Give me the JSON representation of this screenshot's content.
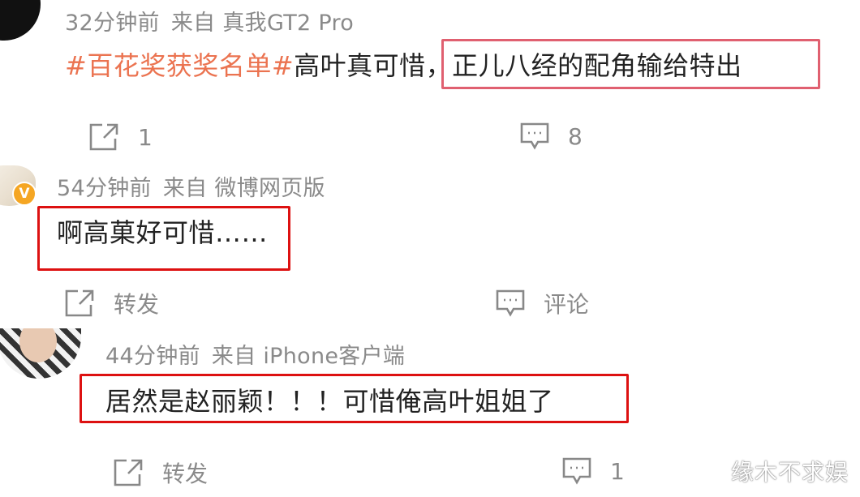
{
  "comments": [
    {
      "time": "32分钟前",
      "source": "来自 真我GT2 Pro",
      "topic": "#百花奖获奖名单#",
      "text_a": "高叶真可惜",
      "text_b": "，正儿八经的配角输给特出",
      "repost": "1",
      "comment": "8",
      "highlight_color": "#e06070"
    },
    {
      "time": "54分钟前",
      "source": "来自 微博网页版",
      "text": "啊高菓好可惜……",
      "repost": "转发",
      "comment": "评论",
      "verified_badge": "V",
      "highlight_color": "#dd1111"
    },
    {
      "time": "44分钟前",
      "source": "来自 iPhone客户端",
      "text": "居然是赵丽颖！！！可惜俺高叶姐姐了",
      "repost": "转发",
      "comment": "1",
      "highlight_color": "#dd1111"
    }
  ],
  "icons": {
    "repost": "share-box-arrow-icon",
    "comment": "speech-bubble-icon",
    "verified": "verified-v-badge-icon"
  },
  "watermark": "缘木不求娱"
}
